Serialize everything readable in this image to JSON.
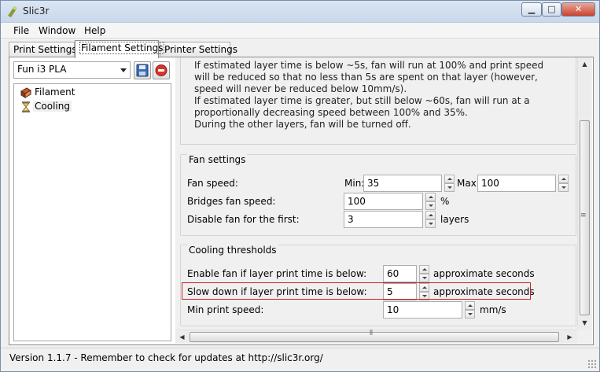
{
  "window": {
    "title": "Slic3r"
  },
  "menu": [
    "File",
    "Window",
    "Help"
  ],
  "tabs": [
    {
      "label": "Print Settings",
      "active": false
    },
    {
      "label": "Filament Settings",
      "active": true
    },
    {
      "label": "Printer Settings",
      "active": false
    }
  ],
  "preset": {
    "selected": "Fun i3 PLA"
  },
  "tree": [
    {
      "label": "Filament",
      "icon": "spool-icon"
    },
    {
      "label": "Cooling",
      "icon": "hourglass-icon",
      "selected": true
    }
  ],
  "description": [
    "If estimated layer time is below ~5s, fan will run at 100% and print speed",
    "will be reduced so that no less than 5s are spent on that layer (however,",
    "speed will never be reduced below 10mm/s).",
    "If estimated layer time is greater, but still below ~60s, fan will run at a",
    "proportionally decreasing speed between 100% and 35%.",
    "During the other layers, fan will be turned off."
  ],
  "fan_settings": {
    "title": "Fan settings",
    "fan_speed_label": "Fan speed:",
    "min_label": "Min:",
    "min_value": "35",
    "max_label": "Max:",
    "max_value": "100",
    "bridges_label": "Bridges fan speed:",
    "bridges_value": "100",
    "bridges_unit": "%",
    "disable_label": "Disable fan for the first:",
    "disable_value": "3",
    "disable_unit": "layers"
  },
  "cooling_thresholds": {
    "title": "Cooling thresholds",
    "enable_label": "Enable fan if layer print time is below:",
    "enable_value": "60",
    "enable_unit": "approximate seconds",
    "slowdown_label": "Slow down if layer print time is below:",
    "slowdown_value": "5",
    "slowdown_unit": "approximate seconds",
    "min_speed_label": "Min print speed:",
    "min_speed_value": "10",
    "min_speed_unit": "mm/s"
  },
  "status": "Version 1.1.7 - Remember to check for updates at http://slic3r.org/",
  "colors": {
    "highlight": "#c8202a",
    "delete_red": "#d9342b",
    "save_blue": "#3b6fb6"
  }
}
